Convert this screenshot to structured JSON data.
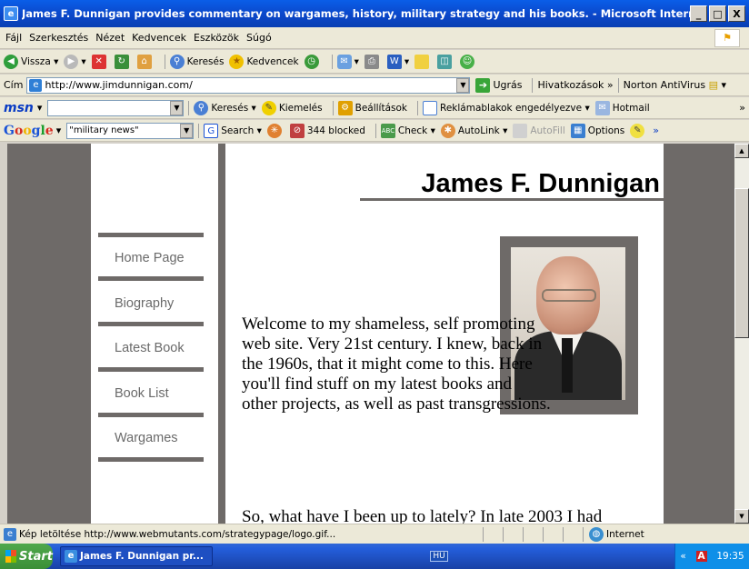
{
  "window": {
    "title": "James F. Dunnigan provides commentary on wargames, history, military strategy and his books. - Microsoft Internet Explorer",
    "min": "_",
    "max": "□",
    "close": "X"
  },
  "menu": [
    "Fájl",
    "Szerkesztés",
    "Nézet",
    "Kedvencek",
    "Eszközök",
    "Súgó"
  ],
  "toolbar": {
    "back": "Vissza",
    "search": "Keresés",
    "favorites": "Kedvencek"
  },
  "address": {
    "label": "Cím",
    "url": "http://www.jimdunnigan.com/",
    "go": "Ugrás",
    "links": "Hivatkozások",
    "norton": "Norton AntiVirus"
  },
  "msn": {
    "logo": "msn",
    "search": "Keresés",
    "highlight": "Kiemelés",
    "settings": "Beállítások",
    "popups": "Reklámablakok engedélyezve",
    "hotmail": "Hotmail"
  },
  "google": {
    "logo": "Google",
    "query": "\"military news\"",
    "search": "Search",
    "blocked": "344 blocked",
    "check": "Check",
    "autolink": "AutoLink",
    "autofill": "AutoFill",
    "options": "Options"
  },
  "page": {
    "site_title": "James F. Dunnigan",
    "nav": [
      "Home Page",
      "Biography",
      "Latest Book",
      "Book List",
      "Wargames"
    ],
    "welcome": "Welcome to my shameless, self promoting web site. Very 21st century. I knew, back in the 1960s, that it might come to this. Here you'll find stuff on my latest books and other projects, as well as past transgressions.",
    "more": "So, what have I been up to lately? In late 2003 I had"
  },
  "status": {
    "text": "Kép letöltése http://www.webmutants.com/strategypage/logo.gif...",
    "zone": "Internet"
  },
  "taskbar": {
    "start": "Start",
    "window": "James F. Dunnigan pr...",
    "lang": "HU",
    "clock": "19:35"
  }
}
